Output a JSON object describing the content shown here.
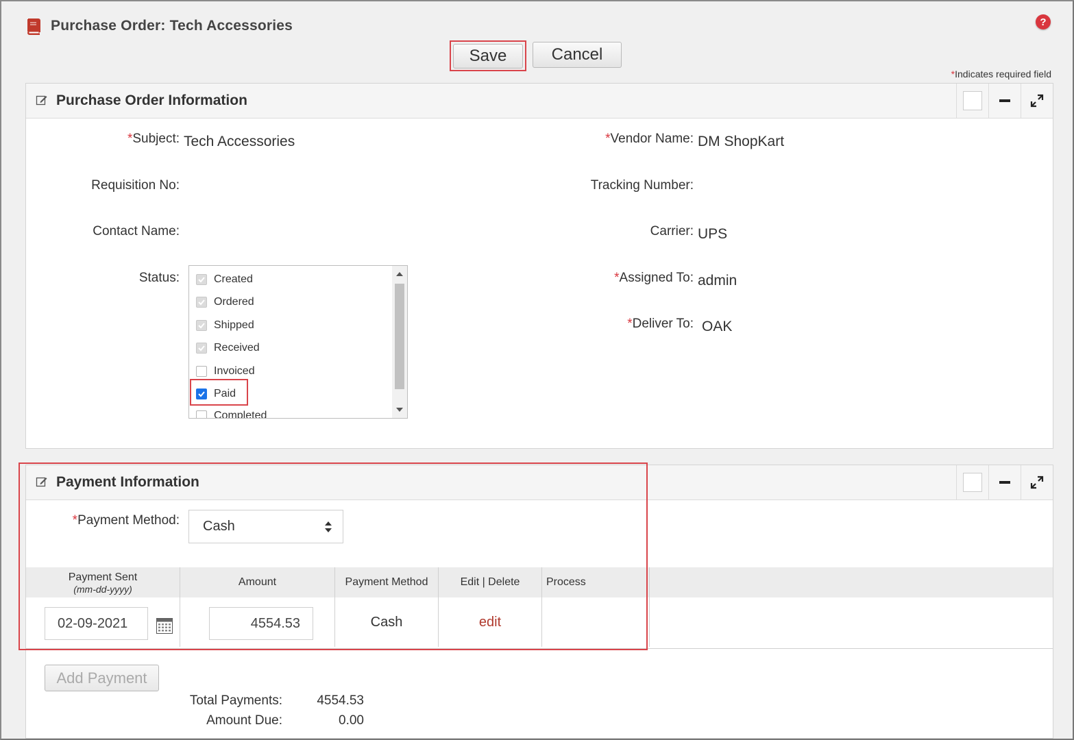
{
  "page": {
    "title": "Purchase Order: Tech Accessories",
    "help_glyph": "?"
  },
  "toolbar": {
    "save_label": "Save",
    "cancel_label": "Cancel"
  },
  "required_note": {
    "star": "*",
    "text": "Indicates required field"
  },
  "po_info": {
    "title": "Purchase Order Information",
    "fields": {
      "subject": {
        "label": "Subject:",
        "value": "Tech Accessories",
        "required": true
      },
      "vendor_name": {
        "label": "Vendor Name:",
        "value": "DM ShopKart",
        "required": true
      },
      "requisition_no": {
        "label": "Requisition No:",
        "value": ""
      },
      "tracking_number": {
        "label": "Tracking Number:",
        "value": ""
      },
      "contact_name": {
        "label": "Contact Name:",
        "value": ""
      },
      "carrier": {
        "label": "Carrier:",
        "value": "UPS"
      },
      "status": {
        "label": "Status:"
      },
      "assigned_to": {
        "label": "Assigned To:",
        "value": "admin",
        "required": true
      },
      "deliver_to": {
        "label": "Deliver To:",
        "value": "OAK",
        "required": true
      }
    },
    "status_options": [
      {
        "label": "Created",
        "state": "checked-disabled"
      },
      {
        "label": "Ordered",
        "state": "checked-disabled"
      },
      {
        "label": "Shipped",
        "state": "checked-disabled"
      },
      {
        "label": "Received",
        "state": "checked-disabled"
      },
      {
        "label": "Invoiced",
        "state": "unchecked"
      },
      {
        "label": "Paid",
        "state": "checked"
      },
      {
        "label": "Completed",
        "state": "unchecked"
      }
    ]
  },
  "payment_info": {
    "title": "Payment Information",
    "payment_method": {
      "label": "Payment Method:",
      "value": "Cash"
    },
    "table": {
      "headers": {
        "payment_sent": "Payment Sent",
        "payment_sent_hint": "(mm-dd-yyyy)",
        "amount": "Amount",
        "payment_method": "Payment Method",
        "edit_delete": "Edit | Delete",
        "process": "Process"
      },
      "rows": [
        {
          "date": "02-09-2021",
          "amount": "4554.53",
          "method": "Cash",
          "action": "edit"
        }
      ]
    },
    "add_payment_label": "Add Payment",
    "totals": {
      "total_payments_label": "Total Payments:",
      "total_payments_value": "4554.53",
      "amount_due_label": "Amount Due:",
      "amount_due_value": "0.00"
    }
  },
  "colors": {
    "required_star": "#d9363e",
    "highlight": "#d9444a",
    "checkbox_checked": "#1a73e8",
    "link": "#b03a2e"
  }
}
